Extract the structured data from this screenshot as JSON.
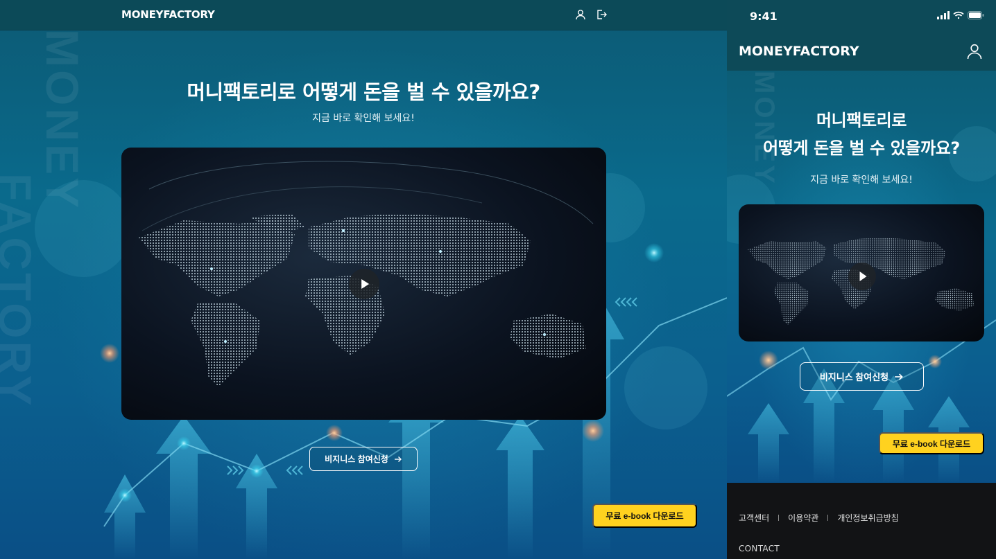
{
  "desktop": {
    "logo": "MONEYFACTORY",
    "header_icons": [
      "user-icon",
      "logout-icon"
    ],
    "watermark_line1": "MONEY",
    "watermark_line2": "FACTORY",
    "title": "머니팩토리로 어떻게 돈을 벌 수 있을까요?",
    "subtitle": "지금 바로 확인해 보세요!",
    "cta_label": "비지니스 참여신청",
    "ebook_label": "무료 e-book 다운로드"
  },
  "mobile": {
    "status_time": "9:41",
    "status_icons": [
      "cellular-signal-icon",
      "wifi-icon",
      "battery-icon"
    ],
    "logo": "MONEYFACTORY",
    "title_line1": "머니팩토리로",
    "title_line2": "어떻게 돈을 벌 수 있을까요?",
    "subtitle": "지금 바로 확인해 보세요!",
    "cta_label": "비지니스 참여신청",
    "ebook_label": "무료 e-book 다운로드",
    "footer_links": [
      "고객센터",
      "이용약관",
      "개인정보취급방침"
    ],
    "footer_contact": "CONTACT"
  },
  "colors": {
    "header_bg": "#0c4a58",
    "accent_yellow": "#ffd21f",
    "hero_blue": "#0b6b8f",
    "footer_bg": "#121315"
  }
}
